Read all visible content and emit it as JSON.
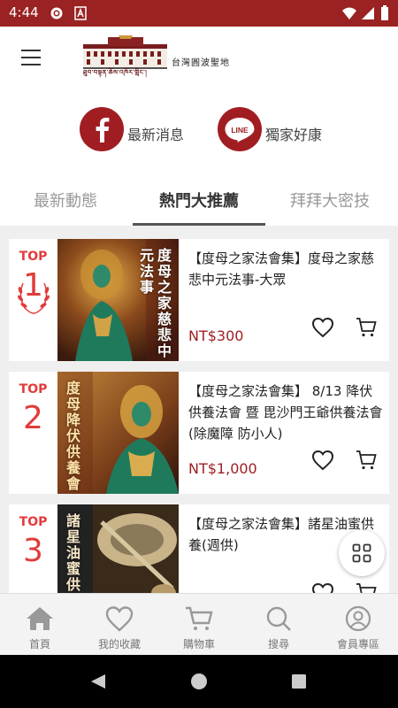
{
  "status_bar": {
    "time": "4:44",
    "icons": [
      "settings-icon",
      "font-icon",
      "wifi-icon",
      "signal-icon",
      "battery-icon"
    ],
    "color": "#9a2222"
  },
  "header": {
    "logo_name": "台灣圓波聖地",
    "logo_script": "ཐུབ་བསྟན་ཆོས་འཁོར་གླིང་།"
  },
  "social": {
    "facebook_label": "最新消息",
    "line_label": "獨家好康",
    "line_icon_text": "LINE",
    "brand_color": "#a01e22"
  },
  "tabs": [
    {
      "label": "最新動態",
      "active": false
    },
    {
      "label": "熱門大推薦",
      "active": true
    },
    {
      "label": "拜拜大密技",
      "active": false
    }
  ],
  "products": [
    {
      "rank_label": "TOP",
      "rank": "1",
      "title": "【度母之家法會集】度母之家慈悲中元法事-大眾",
      "thumb_title": "度母之家慈悲中元法事",
      "price": "NT$300"
    },
    {
      "rank_label": "TOP",
      "rank": "2",
      "title": "【度母之家法會集】 8/13 降伏供養法會 暨 毘沙門王爺供養法會 (除魔障 防小人)",
      "thumb_title": "度母降伏供養會",
      "price": "NT$1,000"
    },
    {
      "rank_label": "TOP",
      "rank": "3",
      "title": "【度母之家法會集】諸星油蜜供養(週供)",
      "thumb_title": "諸星油蜜供養",
      "price": ""
    }
  ],
  "bottom_nav": [
    {
      "label": "首頁",
      "icon": "home-icon"
    },
    {
      "label": "我的收藏",
      "icon": "heart-icon"
    },
    {
      "label": "購物車",
      "icon": "cart-icon"
    },
    {
      "label": "搜尋",
      "icon": "search-icon"
    },
    {
      "label": "會員專區",
      "icon": "user-icon"
    }
  ]
}
